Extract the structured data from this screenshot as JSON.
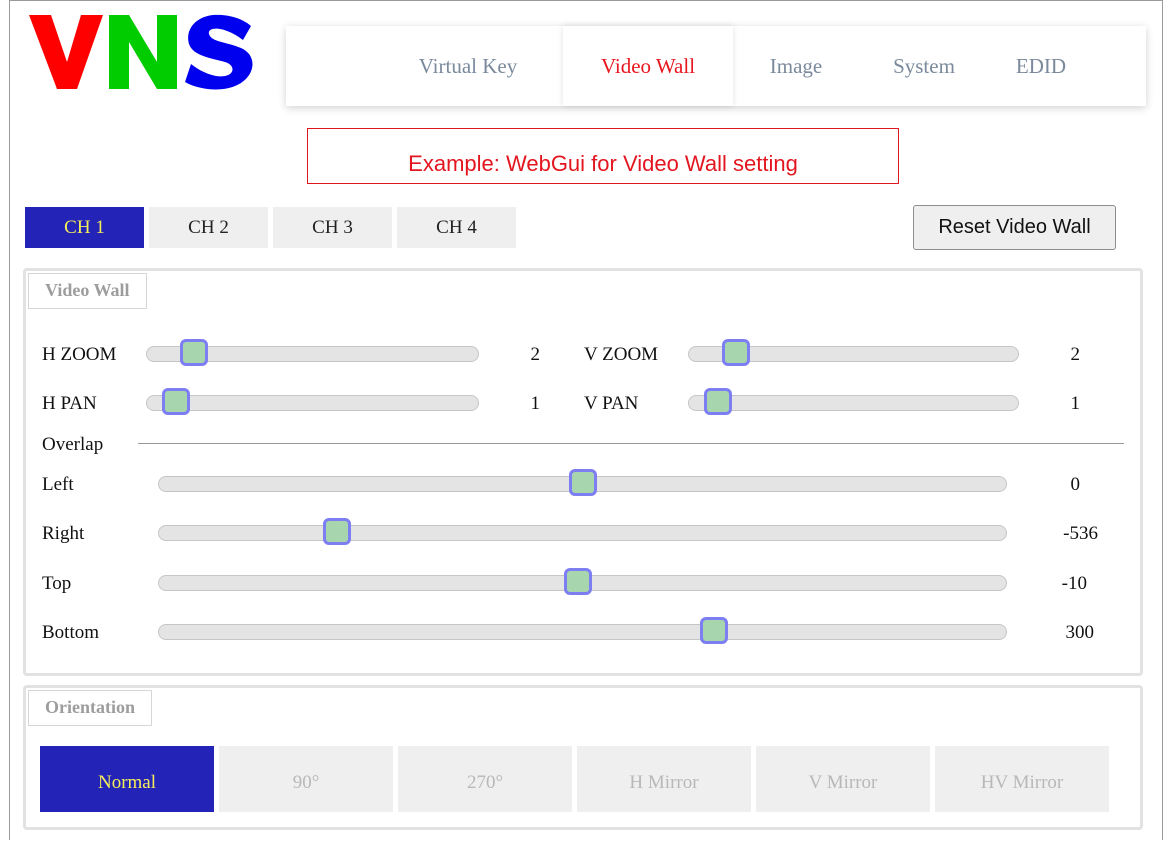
{
  "logo": {
    "text": "VNS",
    "colors": [
      "#ff0000",
      "#00cc00",
      "#0000ee"
    ]
  },
  "nav": {
    "items": [
      {
        "label": "Virtual Key",
        "active": false
      },
      {
        "label": "Video Wall",
        "active": true
      },
      {
        "label": "Image",
        "active": false
      },
      {
        "label": "System",
        "active": false
      },
      {
        "label": "EDID",
        "active": false
      }
    ]
  },
  "example_note": "Example: WebGui for Video Wall setting",
  "channels": {
    "tabs": [
      {
        "label": "CH 1",
        "active": true
      },
      {
        "label": "CH 2",
        "active": false
      },
      {
        "label": "CH 3",
        "active": false
      },
      {
        "label": "CH 4",
        "active": false
      }
    ],
    "reset_label": "Reset Video Wall"
  },
  "video_wall": {
    "legend": "Video Wall",
    "h_zoom": {
      "label": "H ZOOM",
      "value": "2",
      "fraction": 0.11
    },
    "v_zoom": {
      "label": "V ZOOM",
      "value": "2",
      "fraction": 0.11
    },
    "h_pan": {
      "label": "H PAN",
      "value": "1",
      "fraction": 0.05
    },
    "v_pan": {
      "label": "V PAN",
      "value": "1",
      "fraction": 0.05
    },
    "overlap_label": "Overlap",
    "left": {
      "label": "Left",
      "value": "0",
      "fraction": 0.5
    },
    "right": {
      "label": "Right",
      "value": "-536",
      "fraction": 0.2
    },
    "top": {
      "label": "Top",
      "value": "-10",
      "fraction": 0.495
    },
    "bottom": {
      "label": "Bottom",
      "value": "300",
      "fraction": 0.66
    }
  },
  "orientation": {
    "legend": "Orientation",
    "options": [
      {
        "label": "Normal",
        "active": true
      },
      {
        "label": "90°",
        "active": false
      },
      {
        "label": "270°",
        "active": false
      },
      {
        "label": "H Mirror",
        "active": false
      },
      {
        "label": "V Mirror",
        "active": false
      },
      {
        "label": "HV Mirror",
        "active": false
      }
    ]
  },
  "colors": {
    "accent_blue": "#2323b7",
    "active_text_yellow": "#f5ee5a",
    "nav_active_red": "#e8161f",
    "thumb_fill": "#a7d5ae",
    "thumb_border": "#7e7ef3"
  }
}
